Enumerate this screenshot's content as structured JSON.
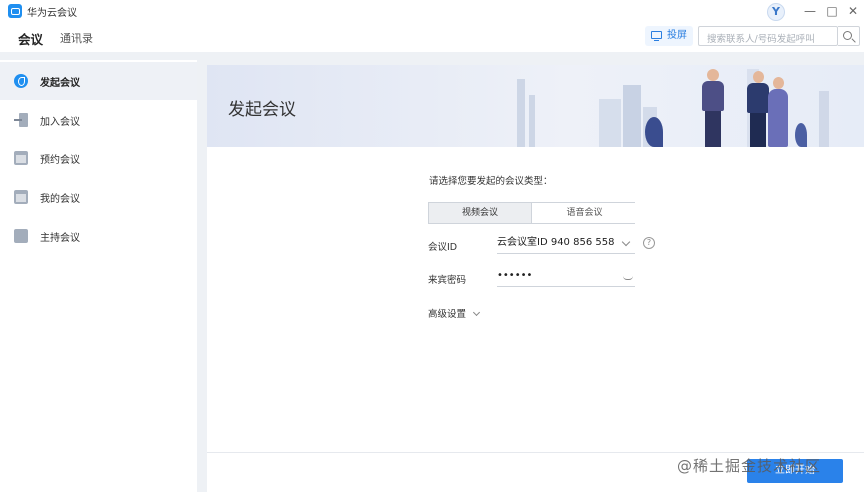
{
  "app": {
    "title": "华为云会议",
    "avatar_letter": "Y"
  },
  "window_controls": {
    "minimize": "—",
    "maximize": "□",
    "close": "✕"
  },
  "nav": {
    "tabs": [
      {
        "label": "会议",
        "active": true
      },
      {
        "label": "通讯录",
        "active": false
      }
    ],
    "cast_label": "投屏",
    "search_placeholder": "搜索联系人/号码发起呼叫"
  },
  "sidebar": {
    "items": [
      {
        "label": "发起会议",
        "icon": "phone-icon",
        "active": true
      },
      {
        "label": "加入会议",
        "icon": "join-icon",
        "active": false
      },
      {
        "label": "预约会议",
        "icon": "calendar-icon",
        "active": false
      },
      {
        "label": "我的会议",
        "icon": "calendar-list-icon",
        "active": false
      },
      {
        "label": "主持会议",
        "icon": "host-icon",
        "active": false
      }
    ]
  },
  "main": {
    "banner_title": "发起会议",
    "prompt": "请选择您要发起的会议类型：",
    "meeting_types": [
      {
        "label": "视频会议",
        "active": true
      },
      {
        "label": "语音会议",
        "active": false
      }
    ],
    "meeting_id": {
      "label": "会议ID",
      "value": "云会议室ID 940 856 558"
    },
    "password": {
      "label": "来宾密码",
      "value": "••••••"
    },
    "advanced_label": "高级设置",
    "start_button": "立即开始",
    "watermark": "@稀土掘金技术社区"
  },
  "colors": {
    "accent": "#2a82ea",
    "sidebar_active_bg": "#eef1f6",
    "backdrop": "#eef1f5"
  }
}
